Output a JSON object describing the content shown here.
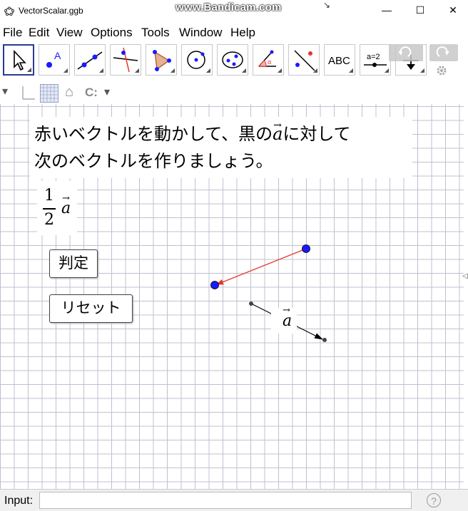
{
  "window": {
    "title": "VectorScalar.ggb",
    "watermark": "www.Bandicam.com",
    "pin_glyph": "↘",
    "minimize": "—",
    "maximize": "☐",
    "close": "✕"
  },
  "menu": [
    "File",
    "Edit",
    "View",
    "Options",
    "Tools",
    "Window",
    "Help"
  ],
  "toolbar": {
    "tools": [
      {
        "name": "move",
        "icon": "arrow-cursor-icon"
      },
      {
        "name": "point",
        "icon": "point-icon"
      },
      {
        "name": "line",
        "icon": "line-icon"
      },
      {
        "name": "perpendicular-line",
        "icon": "perpendicular-line-icon"
      },
      {
        "name": "polygon",
        "icon": "polygon-icon"
      },
      {
        "name": "circle",
        "icon": "circle-icon"
      },
      {
        "name": "conic",
        "icon": "ellipse-icon"
      },
      {
        "name": "angle",
        "icon": "angle-icon"
      },
      {
        "name": "reflect",
        "icon": "reflect-icon"
      },
      {
        "name": "text",
        "icon": "text-icon",
        "label": "ABC"
      },
      {
        "name": "slider",
        "icon": "slider-icon",
        "label": "a=2"
      },
      {
        "name": "move-graphics-view",
        "icon": "move-view-icon"
      }
    ]
  },
  "stylebar": {
    "toggle_glyph": "▾",
    "home_glyph": "⌂",
    "refresh_glyph": "C:",
    "dropdown_glyph": "▾"
  },
  "canvas": {
    "instruction_line1_a": "赤いベクトルを動かして、黒の",
    "instruction_vec": "a",
    "instruction_line1_b": "に対して",
    "instruction_line2": "次のベクトルを作りましょう。",
    "fraction_num": "1",
    "fraction_den": "2",
    "fraction_vec": "a",
    "check_button": "判定",
    "reset_button": "リセット",
    "vector_label": "a",
    "colors": {
      "red_vector": "#e8342b",
      "blue_point": "#1a1aff",
      "black_vector": "#000000"
    }
  },
  "inputbar": {
    "label": "Input:",
    "help": "?"
  }
}
